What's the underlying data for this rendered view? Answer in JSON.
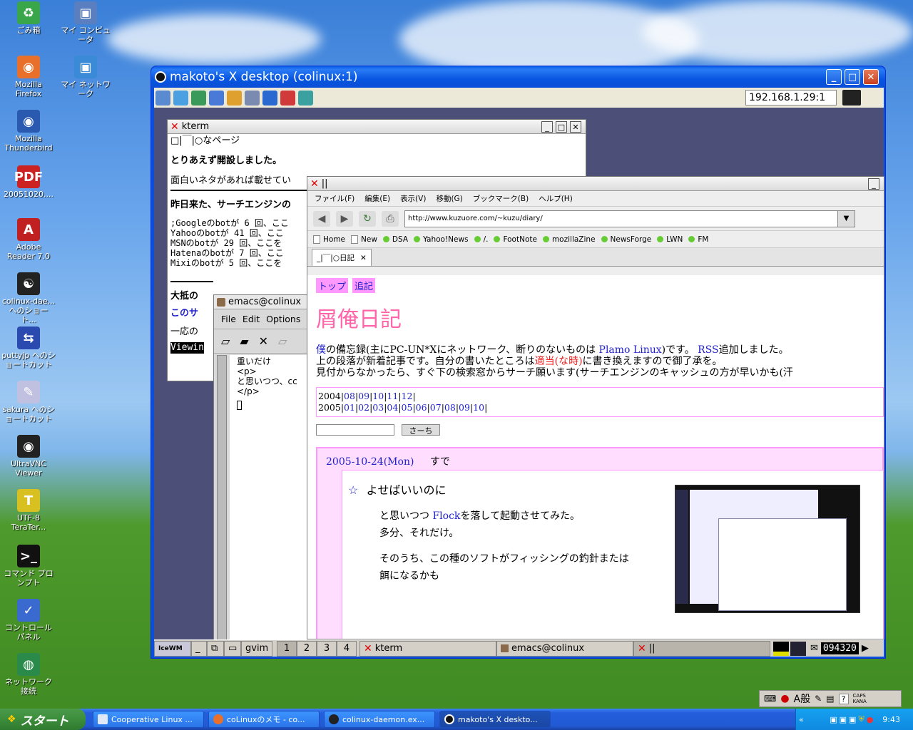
{
  "desktop": {
    "icons": [
      {
        "label": "ごみ箱",
        "glyph": "♻",
        "color": "#3aa64a"
      },
      {
        "label": "マイ コンピュータ",
        "glyph": "▣",
        "color": "#5a7fc0"
      },
      {
        "label": "Mozilla Firefox",
        "glyph": "◉",
        "color": "#e8702a"
      },
      {
        "label": "マイ ネットワーク",
        "glyph": "▣",
        "color": "#3a8ad8"
      },
      {
        "label": "Mozilla Thunderbird",
        "glyph": "◉",
        "color": "#2a5ab0"
      },
      {
        "label": "20051020....",
        "glyph": "PDF",
        "color": "#cc2222"
      },
      {
        "label": "Adobe Reader 7.0",
        "glyph": "A",
        "color": "#c02020"
      },
      {
        "label": "colinux-dae... へのショート...",
        "glyph": "☯",
        "color": "#222"
      },
      {
        "label": "puttyjp へのショートカット",
        "glyph": "⇆",
        "color": "#2a4ab0"
      },
      {
        "label": "sakura へのショートカット",
        "glyph": "✎",
        "color": "#c0c0e0"
      },
      {
        "label": "UltraVNC Viewer",
        "glyph": "◉",
        "color": "#222"
      },
      {
        "label": "UTF-8 TeraTer...",
        "glyph": "T",
        "color": "#d8c020"
      },
      {
        "label": "コマンド プロンプト",
        "glyph": ">_",
        "color": "#111"
      },
      {
        "label": "コントロール パネル",
        "glyph": "✓",
        "color": "#3a6ad0"
      },
      {
        "label": "ネットワーク接続",
        "glyph": "◍",
        "color": "#2a8a4a"
      }
    ]
  },
  "vnc": {
    "title": "makoto's X desktop (colinux:1)",
    "host": "192.168.1.29:1"
  },
  "kterm": {
    "title": "kterm",
    "line1": "□|￣|○なページ",
    "line2": "とりあえず開設しました。",
    "line3": "面白いネタがあれば載せてい",
    "line4": "昨日来た、サーチエンジンの",
    "mono": [
      ";Googleのbotが 6 回、ここ",
      "Yahooのbotが 41 回、ここ",
      "MSNのbotが 29 回、ここを",
      "Hatenaのbotが 7 回、ここ",
      "Mixiのbotが 5 回、ここを"
    ],
    "line5": "大抵の",
    "line6": "このサ",
    "line7": "一応の",
    "status": "Viewin"
  },
  "emacs": {
    "title": "emacs@colinux",
    "menu": [
      "File",
      "Edit",
      "Options"
    ],
    "lines": [
      "重いだけ",
      "<p>",
      "と思いつつ、cc",
      "</p>"
    ]
  },
  "firefox": {
    "title": "||",
    "menu": [
      "ファイル(F)",
      "編集(E)",
      "表示(V)",
      "移動(G)",
      "ブックマーク(B)",
      "ヘルプ(H)"
    ],
    "url": "http://www.kuzuore.com/~kuzu/diary/",
    "bookmarks": [
      "Home",
      "New",
      "DSA",
      "Yahoo!News",
      "/.",
      "FootNote",
      "mozillaZine",
      "NewsForge",
      "LWN",
      "FM"
    ],
    "tab": "_|￣|○日記",
    "page": {
      "nav": [
        "トップ",
        "追記"
      ],
      "title": "屑俺日記",
      "intro1a": "僕",
      "intro1b": "の備忘録(主にPC-UN*Xにネットワーク、断りのないものは ",
      "intro1c": "Plamo Linux",
      "intro1d": ")です。 ",
      "intro1e": "RSS",
      "intro1f": "追加しました。",
      "intro2a": "上の段落が新着記事です。自分の書いたところは",
      "intro2b": "適当(な時)",
      "intro2c": "に書き換えますので御了承を。",
      "intro3": "見付からなかったら、すぐ下の検索窓からサーチ願います(サーチエンジンのキャッシュの方が早いかも(汗",
      "y2004": "2004",
      "m2004": [
        "08",
        "09",
        "10",
        "11",
        "12"
      ],
      "y2005": "2005",
      "m2005": [
        "01",
        "02",
        "03",
        "04",
        "05",
        "06",
        "07",
        "08",
        "09",
        "10"
      ],
      "search_btn": "さーち",
      "date": "2005-10-24(Mon)",
      "date_title": "すで",
      "entry_title": "よせばいいのに",
      "p1a": "と思いつつ ",
      "p1b": "Flock",
      "p1c": "を落して起動させてみた。",
      "p2": "多分、それだけ。",
      "p3": "そのうち、この種のソフトがフィッシングの釣針または",
      "p4": "餌になるかも"
    }
  },
  "xbar": {
    "gvim": "gvim",
    "desks": [
      "1",
      "2",
      "3",
      "4"
    ],
    "tasks": [
      "kterm",
      "emacs@colinux",
      "||"
    ],
    "clock": "094320"
  },
  "taskbar": {
    "start": "スタート",
    "items": [
      "Cooperative Linux ...",
      "coLinuxのメモ - co...",
      "colinux-daemon.ex...",
      "makoto's X deskto..."
    ],
    "ime": "A般",
    "caps": "CAPS",
    "kana": "KANA",
    "time": "9:43"
  }
}
